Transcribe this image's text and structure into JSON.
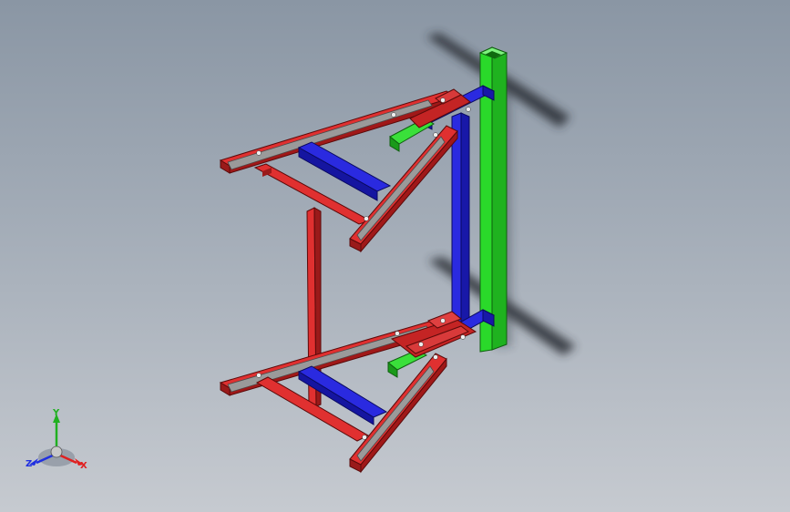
{
  "viewport": {
    "model_colors": {
      "frame": "#d42020",
      "frame_dark": "#8a0e0e",
      "crossbar": "#2020d8",
      "crossbar_dark": "#10107a",
      "post": "#22e022",
      "post_dark": "#128a12",
      "grey_plate": "#9a9a9a",
      "shadow": "#2a2f36"
    }
  },
  "triad": {
    "x_label": "X",
    "y_label": "Y",
    "z_label": "Z",
    "x_color": "#e02020",
    "y_color": "#20b020",
    "z_color": "#2030e0"
  }
}
